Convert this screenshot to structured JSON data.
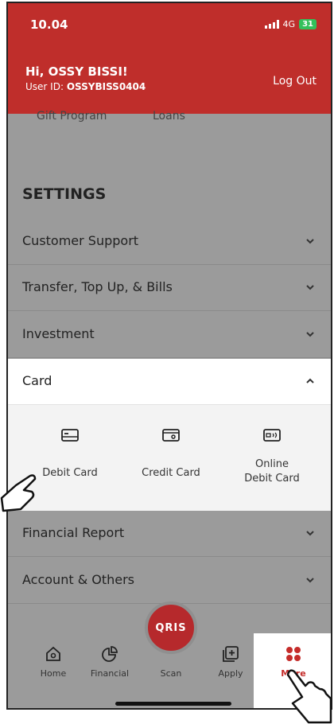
{
  "status": {
    "time": "10.04",
    "network": "4G",
    "battery": "31"
  },
  "header": {
    "greeting": "Hi, OSSY BISSI!",
    "user_id_label": "User ID:",
    "user_id": "OSSYBISS0404",
    "logout": "Log Out"
  },
  "partial": {
    "left": "Gift Program",
    "right": "Loans"
  },
  "settings": {
    "title": "SETTINGS",
    "items": [
      {
        "label": "Customer Support"
      },
      {
        "label": "Transfer, Top Up, & Bills"
      },
      {
        "label": "Investment"
      },
      {
        "label": "Card"
      },
      {
        "label": "Financial Report"
      },
      {
        "label": "Account & Others"
      }
    ]
  },
  "card_options": [
    {
      "label": "Debit Card"
    },
    {
      "label": "Credit Card"
    },
    {
      "label_line1": "Online",
      "label_line2": "Debit Card"
    }
  ],
  "qris": "QRIS",
  "nav": [
    {
      "label": "Home",
      "icon": "home-icon"
    },
    {
      "label": "Financial",
      "icon": "pie-chart-icon"
    },
    {
      "label": "Scan",
      "icon": "qris-icon"
    },
    {
      "label": "Apply",
      "icon": "apply-icon"
    },
    {
      "label": "More",
      "icon": "more-grid-icon"
    }
  ],
  "colors": {
    "brand_red": "#bf2e2b",
    "more_red": "#c52c2a",
    "overlay_gray": "#9b9b9b"
  }
}
